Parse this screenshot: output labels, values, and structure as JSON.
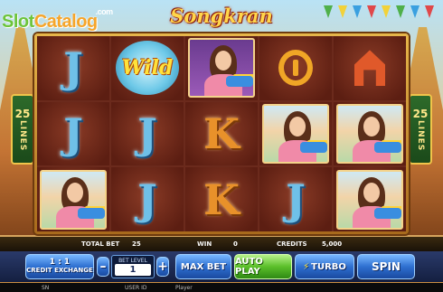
{
  "logo": {
    "part1": "Slot",
    "part2": "Catalog",
    "suffix": ".com"
  },
  "game": {
    "title": "Songkran"
  },
  "lines": {
    "count": "25",
    "word": "LINES"
  },
  "reels": [
    [
      "j",
      "wild",
      "girl-purple",
      "baht",
      "arch"
    ],
    [
      "j",
      "j",
      "k",
      "girl",
      "girl"
    ],
    [
      "girl",
      "j",
      "k",
      "j",
      "girl"
    ]
  ],
  "symbols": {
    "j": "J",
    "k": "K",
    "wild": "Wild"
  },
  "info": {
    "total_bet_label": "TOTAL BET",
    "total_bet_value": "25",
    "win_label": "WIN",
    "win_value": "0",
    "credits_label": "CREDITS",
    "credits_value": "5,000"
  },
  "controls": {
    "credit_exchange_ratio": "1 : 1",
    "credit_exchange_label": "CREDIT EXCHANGE",
    "minus": "–",
    "plus": "+",
    "bet_level_label": "BET LEVEL",
    "bet_level_value": "1",
    "max_bet": "MAX BET",
    "auto_play": "AUTO PLAY",
    "turbo": "TURBO",
    "spin": "SPIN"
  },
  "status": {
    "sn_label": "SN",
    "user_id_label": "USER ID",
    "user_id_value": "Player"
  },
  "colors": {
    "flags": [
      "#4fb04a",
      "#f2d23a",
      "#3aa0e0",
      "#e0484a",
      "#f2d23a",
      "#4fb04a",
      "#3aa0e0",
      "#e0484a"
    ]
  }
}
